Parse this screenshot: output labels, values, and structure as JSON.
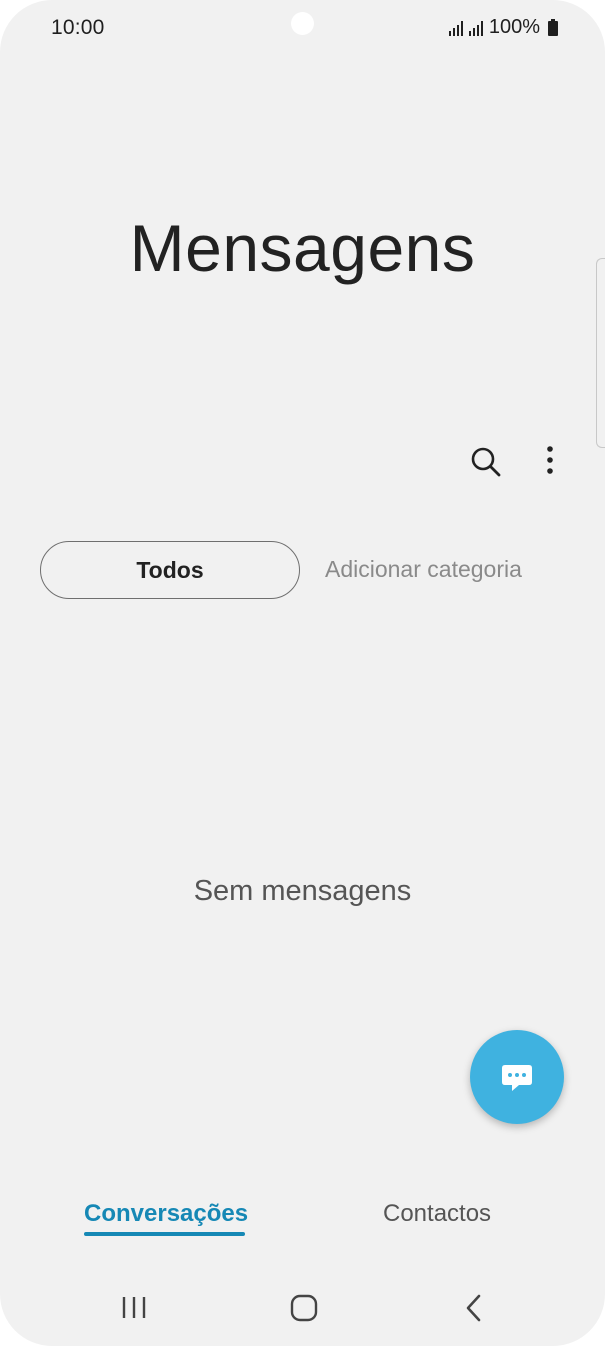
{
  "status_bar": {
    "time": "10:00",
    "battery": "100%",
    "icons": [
      "signal-icon",
      "signal-icon",
      "battery-icon"
    ]
  },
  "header": {
    "title": "Mensagens"
  },
  "toolbar": {
    "search_icon": "search-icon",
    "more_icon": "more-options-icon"
  },
  "filters": {
    "all_label": "Todos",
    "add_category_label": "Adicionar categoria"
  },
  "main": {
    "empty_text": "Sem mensagens"
  },
  "fab": {
    "icon": "new-message-icon",
    "color": "#3fb2e0"
  },
  "tabs": [
    {
      "label": "Conversações",
      "active": true
    },
    {
      "label": "Contactos",
      "active": false
    }
  ],
  "nav": {
    "recents_icon": "recent-apps-icon",
    "home_icon": "home-icon",
    "back_icon": "back-icon"
  },
  "colors": {
    "accent": "#1688b5",
    "background": "#f1f1f1"
  }
}
